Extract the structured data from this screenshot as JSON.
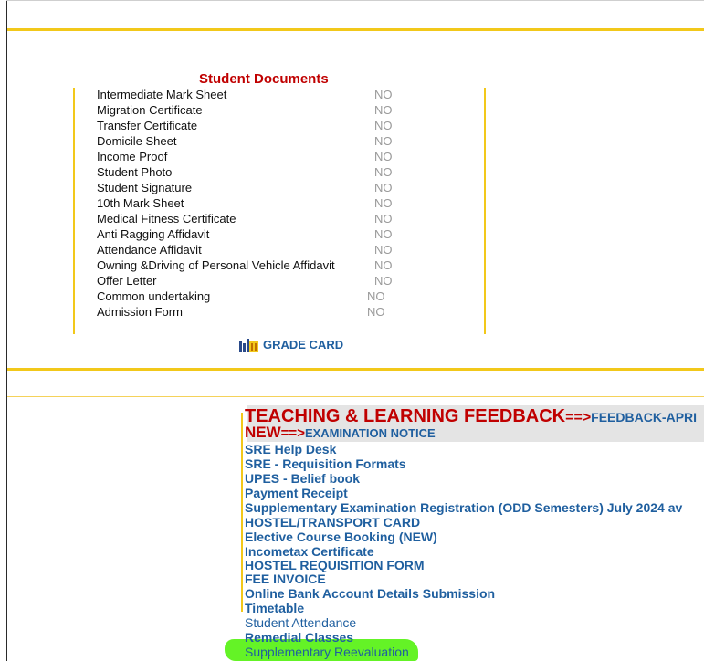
{
  "documents": {
    "title": "Student Documents",
    "items": [
      {
        "name": "Intermediate Mark Sheet",
        "status": "NO"
      },
      {
        "name": "Migration Certificate",
        "status": "NO"
      },
      {
        "name": "Transfer Certificate",
        "status": "NO"
      },
      {
        "name": "Domicile Sheet",
        "status": "NO"
      },
      {
        "name": "Income Proof",
        "status": "NO"
      },
      {
        "name": "Student Photo",
        "status": "NO"
      },
      {
        "name": "Student Signature",
        "status": "NO"
      },
      {
        "name": "10th Mark Sheet",
        "status": "NO"
      },
      {
        "name": "Medical Fitness Certificate",
        "status": "NO"
      },
      {
        "name": "Anti Ragging Affidavit",
        "status": "NO"
      },
      {
        "name": "Attendance Affidavit",
        "status": "NO"
      },
      {
        "name": "Owning &Driving of Personal Vehicle Affidavit",
        "status": "NO"
      },
      {
        "name": "Offer Letter",
        "status": "NO"
      },
      {
        "name": "Common undertaking",
        "status": "NO"
      },
      {
        "name": "Admission Form",
        "status": "NO"
      }
    ]
  },
  "grade_card": {
    "label": "GRADE CARD",
    "icon": "chart-icon"
  },
  "feedback": {
    "heading": "TEACHING & LEARNING FEEDBACK",
    "arrow1": "==>",
    "link1": "FEEDBACK-APRI",
    "new_label": "NEW",
    "arrow2": "==>",
    "link2": "EXAMINATION NOTICE"
  },
  "links": [
    "SRE Help Desk",
    "SRE - Requisition Formats",
    "UPES - Belief book",
    "Payment Receipt",
    "Supplementary Examination Registration (ODD Semesters) July 2024 av",
    "HOSTEL/TRANSPORT CARD",
    "Elective Course Booking (NEW)",
    "Incometax Certificate",
    "HOSTEL REQUISITION FORM",
    "FEE INVOICE",
    "Online Bank Account Details Submission",
    "Timetable",
    "Student Attendance",
    "Remedial Classes",
    "Supplementary Reevaluation"
  ],
  "colors": {
    "accent_yellow": "#f2c81a",
    "heading_red": "#c00000",
    "link_blue": "#1f5f9f",
    "highlight_green": "#5cf21a"
  }
}
